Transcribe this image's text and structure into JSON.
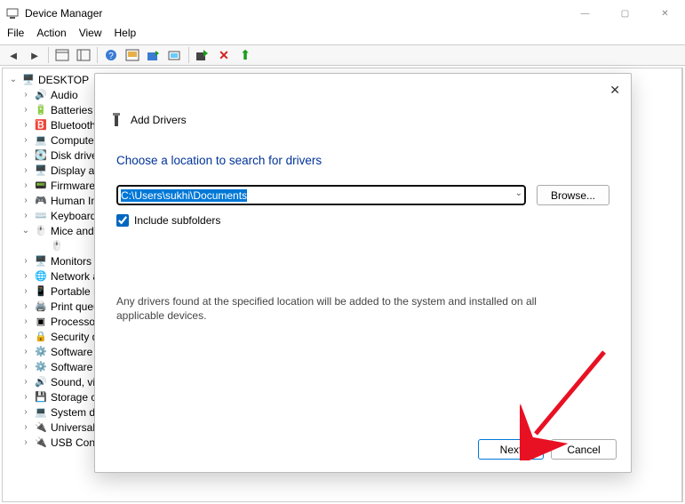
{
  "window": {
    "title": "Device Manager"
  },
  "menu": {
    "file": "File",
    "action": "Action",
    "view": "View",
    "help": "Help"
  },
  "tree": {
    "root": "DESKTOP",
    "items": [
      {
        "label": "Audio",
        "exp": "closed"
      },
      {
        "label": "Batteries",
        "exp": "closed"
      },
      {
        "label": "Bluetooth",
        "exp": "closed"
      },
      {
        "label": "Computer",
        "exp": "closed"
      },
      {
        "label": "Disk drives",
        "exp": "closed"
      },
      {
        "label": "Display adapters",
        "exp": "closed"
      },
      {
        "label": "Firmware",
        "exp": "closed"
      },
      {
        "label": "Human Interface Devices",
        "exp": "closed"
      },
      {
        "label": "Keyboards",
        "exp": "closed"
      },
      {
        "label": "Mice and other pointing devices",
        "exp": "open"
      },
      {
        "label": "",
        "exp": "",
        "child": true
      },
      {
        "label": "Monitors",
        "exp": "closed"
      },
      {
        "label": "Network adapters",
        "exp": "closed"
      },
      {
        "label": "Portable Devices",
        "exp": "closed"
      },
      {
        "label": "Print queues",
        "exp": "closed"
      },
      {
        "label": "Processors",
        "exp": "closed"
      },
      {
        "label": "Security devices",
        "exp": "closed"
      },
      {
        "label": "Software components",
        "exp": "closed"
      },
      {
        "label": "Software devices",
        "exp": "closed"
      },
      {
        "label": "Sound, video and game controllers",
        "exp": "closed"
      },
      {
        "label": "Storage controllers",
        "exp": "closed"
      },
      {
        "label": "System devices",
        "exp": "closed"
      },
      {
        "label": "Universal Serial Bus controllers",
        "exp": "closed"
      },
      {
        "label": "USB Connector Managers",
        "exp": "closed"
      }
    ]
  },
  "dialog": {
    "title": "Add Drivers",
    "heading": "Choose a location to search for drivers",
    "path": "C:\\Users\\sukhi\\Documents",
    "browse": "Browse...",
    "include_subfolders": "Include subfolders",
    "include_checked": true,
    "description": "Any drivers found at the specified location will be added to the system and installed on all applicable devices.",
    "next": "Next",
    "cancel": "Cancel"
  }
}
